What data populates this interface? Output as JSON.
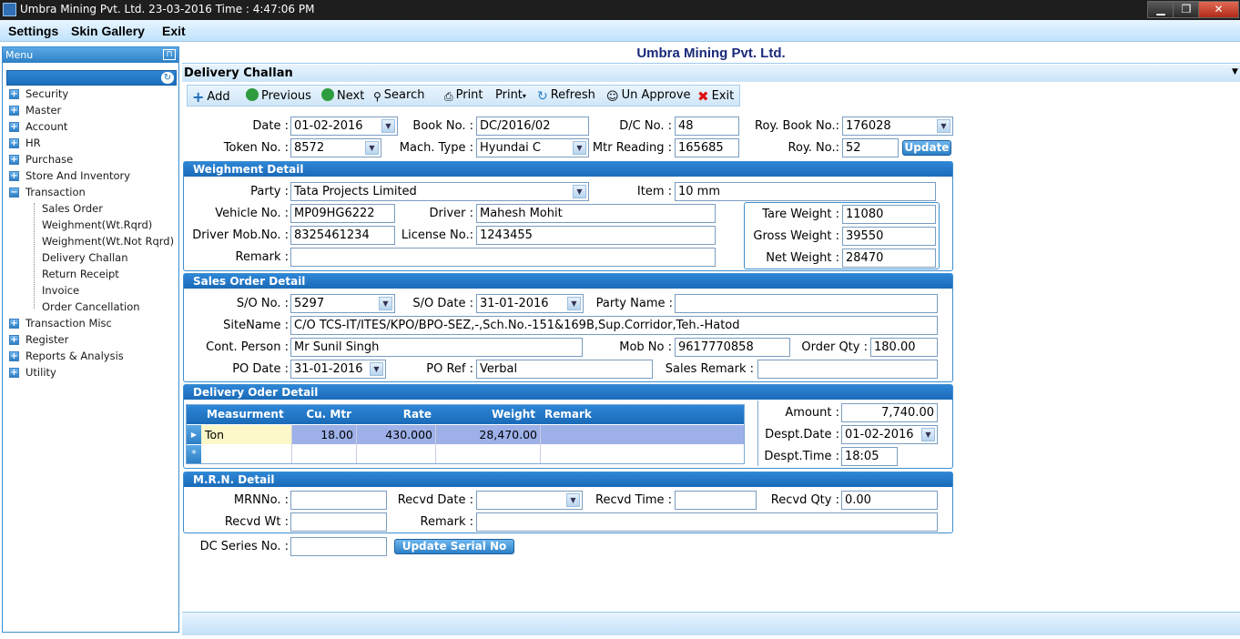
{
  "window": {
    "title": "Umbra Mining Pvt. Ltd. 23-03-2016 Time : 4:47:06 PM",
    "min": "▁",
    "max": "❐",
    "close": "✕"
  },
  "menubar": [
    "Settings",
    "Skin Gallery",
    "Exit"
  ],
  "sidebar": {
    "header": "Menu",
    "items": [
      "Security",
      "Master",
      "Account",
      "HR",
      "Purchase",
      "Store And Inventory",
      "Transaction",
      "Transaction Misc",
      "Register",
      "Reports & Analysis",
      "Utility"
    ],
    "transaction_children": [
      "Sales Order",
      "Weighment(Wt.Rqrd)",
      "Weighment(Wt.Not Rqrd)",
      "Delivery Challan",
      "Return Receipt",
      "Invoice",
      "Order Cancellation"
    ]
  },
  "app_title": "Umbra Mining Pvt. Ltd.",
  "form_title": "Delivery Challan",
  "toolbar": {
    "add": "Add",
    "previous": "Previous",
    "next": "Next",
    "search": "Search",
    "print1": "Print",
    "print2": "Print",
    "refresh": "Refresh",
    "unapprove": "Un Approve",
    "exit": "Exit"
  },
  "header_fields": {
    "date_label": "Date :",
    "date": "01-02-2016",
    "book_label": "Book No. :",
    "book": "DC/2016/02",
    "dc_label": "D/C No. :",
    "dc": "48",
    "roybook_label": "Roy. Book No.:",
    "roybook": "176028",
    "token_label": "Token No. :",
    "token": "8572",
    "mach_label": "Mach. Type :",
    "mach": "Hyundai C",
    "mtr_label": "Mtr Reading :",
    "mtr": "165685",
    "royno_label": "Roy. No.:",
    "royno": "52",
    "update": "Update"
  },
  "weighment": {
    "title": "Weighment Detail",
    "party_label": "Party :",
    "party": "Tata Projects Limited",
    "item_label": "Item :",
    "item": "10 mm",
    "vehicle_label": "Vehicle No. :",
    "vehicle": "MP09HG6222",
    "driver_label": "Driver :",
    "driver": "Mahesh Mohit",
    "mob_label": "Driver Mob.No. :",
    "mob": "8325461234",
    "license_label": "License No.:",
    "license": "1243455",
    "remark_label": "Remark :",
    "remark": "",
    "tare_label": "Tare Weight :",
    "tare": "11080",
    "gross_label": "Gross Weight :",
    "gross": "39550",
    "net_label": "Net Weight :",
    "net": "28470"
  },
  "sales_order": {
    "title": "Sales Order Detail",
    "so_label": "S/O No. :",
    "so": "5297",
    "sodate_label": "S/O Date :",
    "sodate": "31-01-2016",
    "partyname_label": "Party Name :",
    "partyname": "",
    "site_label": "SiteName :",
    "site": "C/O TCS-IT/ITES/KPO/BPO-SEZ,-,Sch.No.-151&169B,Sup.Corridor,Teh.-Hatod",
    "cont_label": "Cont. Person :",
    "cont": "Mr Sunil Singh",
    "mobno_label": "Mob No :",
    "mobno": "9617770858",
    "qty_label": "Order Qty :",
    "qty": "180.00",
    "podate_label": "PO Date :",
    "podate": "31-01-2016",
    "poref_label": "PO Ref :",
    "poref": "Verbal",
    "salesremark_label": "Sales Remark :",
    "salesremark": ""
  },
  "delivery": {
    "title": "Delivery Oder Detail",
    "columns": [
      "Measurment",
      "Cu. Mtr",
      "Rate",
      "Weight",
      "Remark"
    ],
    "row": [
      "Ton",
      "18.00",
      "430.000",
      "28,470.00",
      ""
    ],
    "new_row_marker": "*",
    "row_marker": "▶",
    "amount_label": "Amount :",
    "amount": "7,740.00",
    "desptdate_label": "Despt.Date :",
    "desptdate": "01-02-2016",
    "despttime_label": "Despt.Time :",
    "despttime": "18:05"
  },
  "mrn": {
    "title": "M.R.N. Detail",
    "mrnno_label": "MRNNo. :",
    "mrnno": "",
    "recvddate_label": "Recvd Date :",
    "recvddate": "",
    "recvdtime_label": "Recvd Time :",
    "recvdtime": "",
    "recvdqty_label": "Recvd Qty :",
    "recvdqty": "0.00",
    "recvdwt_label": "Recvd Wt :",
    "recvdwt": "",
    "remark_label": "Remark :",
    "remark": ""
  },
  "dc_series": {
    "label": "DC Series No. :",
    "value": "",
    "button": "Update Serial No"
  }
}
